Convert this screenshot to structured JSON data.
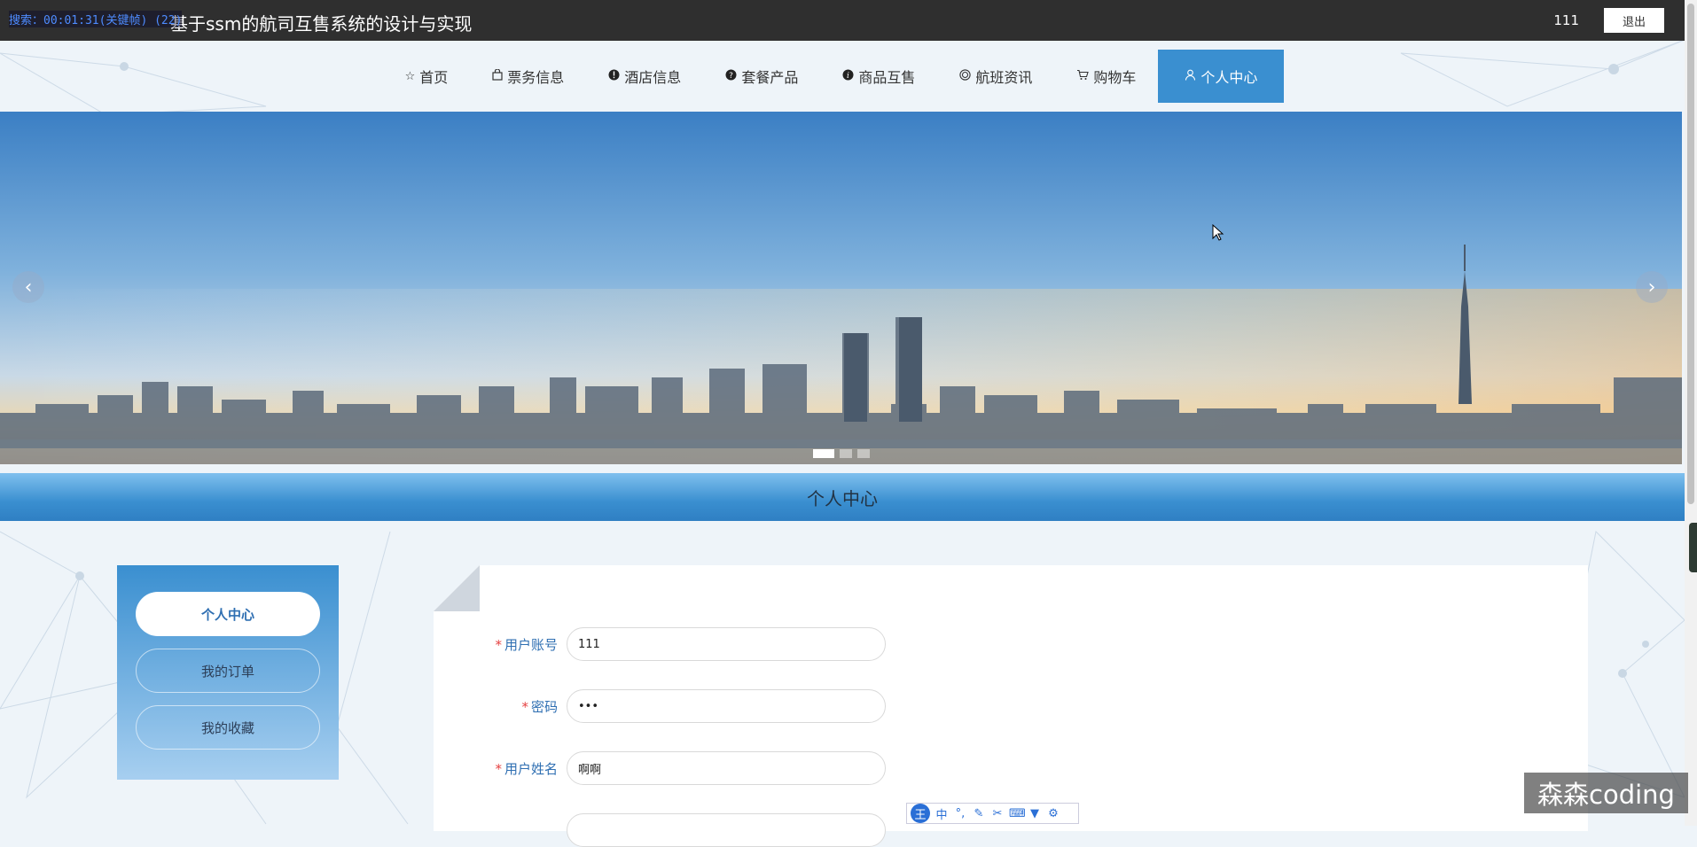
{
  "header": {
    "overlay_text": "搜索：00:01:31(关键帧) (22)",
    "title": "基于ssm的航司互售系统的设计与实现",
    "username": "111",
    "logout_label": "退出"
  },
  "nav": {
    "items": [
      {
        "label": "首页",
        "icon": "star-icon"
      },
      {
        "label": "票务信息",
        "icon": "bag-icon"
      },
      {
        "label": "酒店信息",
        "icon": "info-icon"
      },
      {
        "label": "套餐产品",
        "icon": "question-icon"
      },
      {
        "label": "商品互售",
        "icon": "info-icon"
      },
      {
        "label": "航班资讯",
        "icon": "target-icon"
      },
      {
        "label": "购物车",
        "icon": "cart-icon"
      },
      {
        "label": "个人中心",
        "icon": "user-icon",
        "active": true
      }
    ]
  },
  "banner": {
    "prev": "‹",
    "next": "›",
    "slides": 3,
    "active_slide": 1
  },
  "section": {
    "title": "个人中心"
  },
  "sidebar": {
    "items": [
      {
        "label": "个人中心",
        "active": true
      },
      {
        "label": "我的订单"
      },
      {
        "label": "我的收藏"
      }
    ]
  },
  "form": {
    "fields": [
      {
        "label": "用户账号",
        "required": true,
        "value": "111",
        "type": "text"
      },
      {
        "label": "密码",
        "required": true,
        "value": "•••",
        "type": "password"
      },
      {
        "label": "用户姓名",
        "required": true,
        "value": "啊啊",
        "type": "text"
      }
    ]
  },
  "ime": {
    "logo": "王",
    "mode": "中"
  },
  "watermark": "森森coding",
  "colors": {
    "accent": "#3a8fd0",
    "topbar": "#2f2f2f",
    "required": "#e54040"
  }
}
